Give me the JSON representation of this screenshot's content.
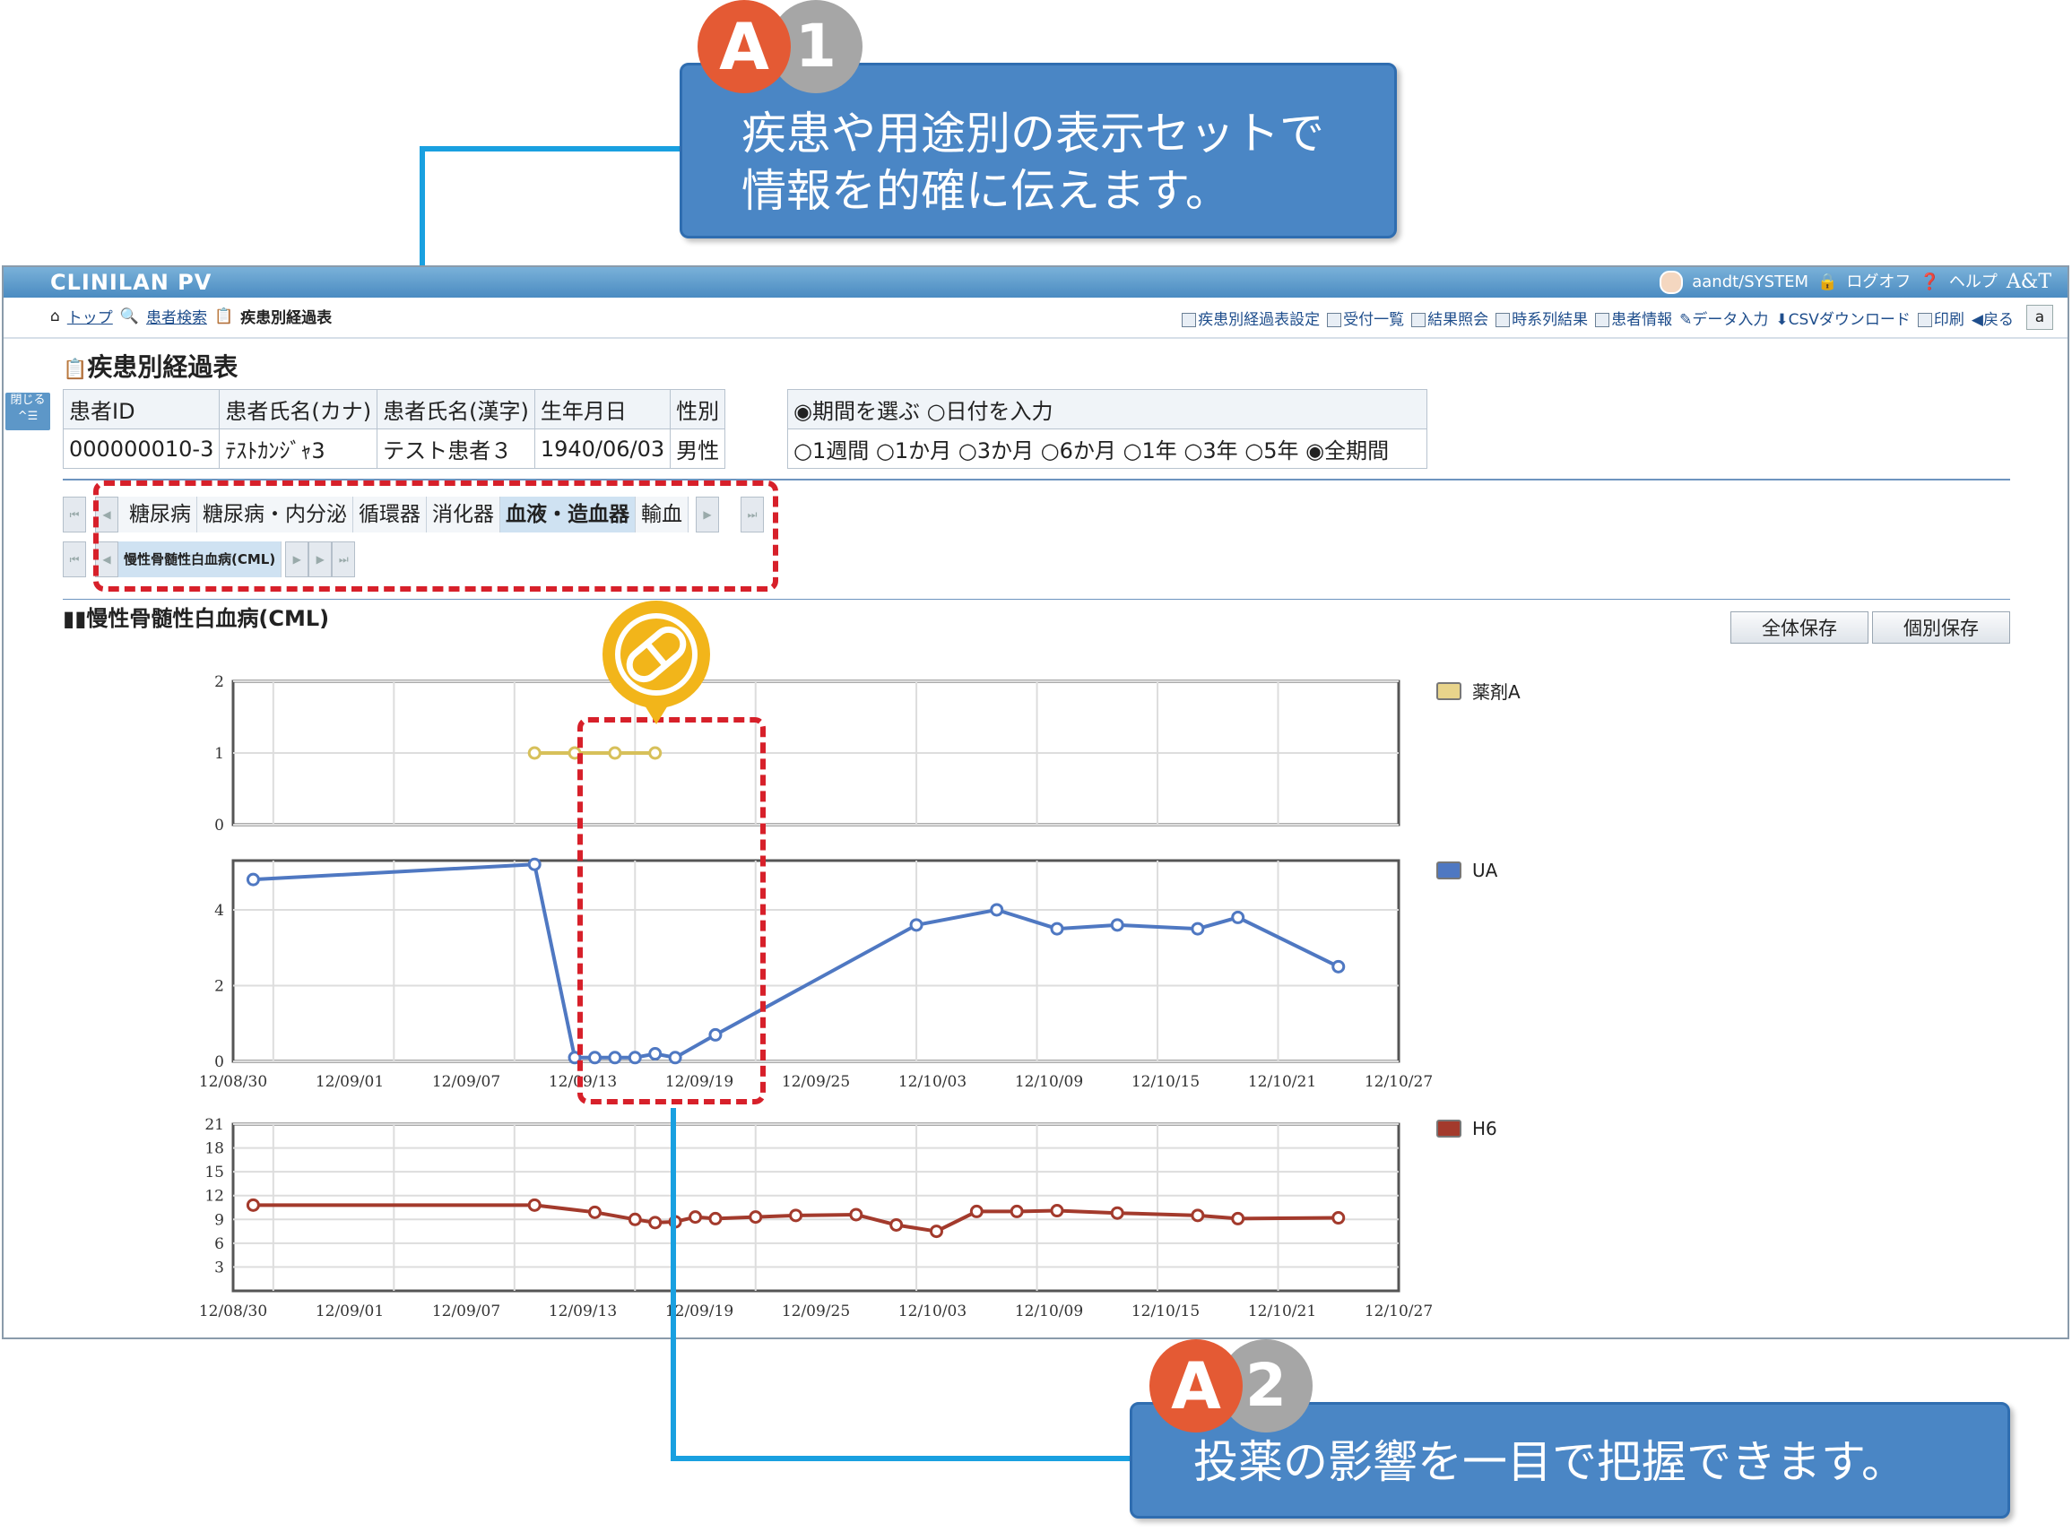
{
  "callouts": {
    "c1": {
      "badge_letter": "A",
      "badge_number": "1",
      "line1": "疾患や用途別の表示セットで",
      "line2": "情報を的確に伝えます。"
    },
    "c2": {
      "badge_letter": "A",
      "badge_number": "2",
      "line1": "投薬の影響を一目で把握できます。"
    }
  },
  "app": {
    "title": "CLINILAN PV",
    "user": "aandt/SYSTEM",
    "logout": "ログオフ",
    "help": "ヘルプ",
    "brand": "A&T",
    "breadcrumb": [
      "トップ",
      "患者検索",
      "疾患別経過表"
    ],
    "toolbar": [
      "疾患別経過表設定",
      "受付一覧",
      "結果照会",
      "時系列結果",
      "患者情報",
      "データ入力",
      "CSVダウンロード",
      "印刷",
      "戻る"
    ],
    "toolbar_last": "a",
    "close_tab": "閉じる",
    "page_title": "疾患別経過表"
  },
  "patient": {
    "headers": [
      "患者ID",
      "患者氏名(カナ)",
      "患者氏名(漢字)",
      "生年月日",
      "性別"
    ],
    "values": [
      "000000010-3",
      "ﾃｽﾄｶﾝｼﾞｬ3",
      "テスト患者３",
      "1940/06/03",
      "男性"
    ]
  },
  "period": {
    "mode_options": [
      "期間を選ぶ",
      "日付を入力"
    ],
    "mode_selected": 0,
    "ranges": [
      "1週間",
      "1か月",
      "3か月",
      "6か月",
      "1年",
      "3年",
      "5年",
      "全期間"
    ],
    "range_selected": 7
  },
  "tabs": {
    "row1": [
      "糖尿病",
      "糖尿病・内分泌",
      "循環器",
      "消化器",
      "血液・造血器",
      "輸血"
    ],
    "row1_active": 4,
    "row2": [
      "慢性骨髄性白血病(CML)"
    ],
    "row2_active": 0
  },
  "chart_section": {
    "title": "慢性骨髄性白血病(CML)",
    "save_all": "全体保存",
    "save_each": "個別保存"
  },
  "chart_data": [
    {
      "type": "line",
      "series": [
        {
          "name": "薬剤A",
          "color": "#d7c05a",
          "x": [
            "2012-09-14",
            "2012-09-16",
            "2012-09-18",
            "2012-09-20"
          ],
          "values": [
            1,
            1,
            1,
            1
          ]
        }
      ],
      "ylim": [
        0,
        2
      ],
      "yticks": [
        0,
        1,
        2
      ],
      "xlim": [
        "2012-08-30",
        "2012-10-27"
      ]
    },
    {
      "type": "line",
      "series": [
        {
          "name": "UA",
          "color": "#4f78c2",
          "x": [
            "2012-08-31",
            "2012-09-14",
            "2012-09-16",
            "2012-09-17",
            "2012-09-18",
            "2012-09-19",
            "2012-09-20",
            "2012-09-21",
            "2012-09-23",
            "2012-10-03",
            "2012-10-07",
            "2012-10-10",
            "2012-10-13",
            "2012-10-17",
            "2012-10-19",
            "2012-10-24"
          ],
          "values": [
            4.8,
            5.2,
            0.1,
            0.1,
            0.1,
            0.1,
            0.2,
            0.1,
            0.7,
            3.6,
            4.0,
            3.5,
            3.6,
            3.5,
            3.8,
            2.5
          ]
        }
      ],
      "ylim": [
        0,
        5.3
      ],
      "yticks": [
        0,
        2,
        4
      ],
      "xlim": [
        "2012-08-30",
        "2012-10-27"
      ],
      "xticks": [
        "12/08/30",
        "12/09/01",
        "12/09/07",
        "12/09/13",
        "12/09/19",
        "12/09/25",
        "12/10/03",
        "12/10/09",
        "12/10/15",
        "12/10/21",
        "12/10/27"
      ]
    },
    {
      "type": "line",
      "series": [
        {
          "name": "H6",
          "color": "#a33a2c",
          "x": [
            "2012-08-31",
            "2012-09-14",
            "2012-09-17",
            "2012-09-19",
            "2012-09-20",
            "2012-09-21",
            "2012-09-22",
            "2012-09-23",
            "2012-09-25",
            "2012-09-27",
            "2012-09-30",
            "2012-10-02",
            "2012-10-04",
            "2012-10-06",
            "2012-10-08",
            "2012-10-10",
            "2012-10-13",
            "2012-10-17",
            "2012-10-19",
            "2012-10-24"
          ],
          "values": [
            10.8,
            10.8,
            9.9,
            9.0,
            8.6,
            8.7,
            9.3,
            9.1,
            9.3,
            9.5,
            9.6,
            8.3,
            7.5,
            10.0,
            10.0,
            10.1,
            9.8,
            9.5,
            9.1,
            9.2
          ]
        }
      ],
      "ylim": [
        0,
        21
      ],
      "yticks": [
        3,
        6,
        9,
        12,
        15,
        18,
        21
      ],
      "xlim": [
        "2012-08-30",
        "2012-10-27"
      ],
      "xticks": [
        "12/08/30",
        "12/09/01",
        "12/09/07",
        "12/09/13",
        "12/09/19",
        "12/09/25",
        "12/10/03",
        "12/10/09",
        "12/10/15",
        "12/10/21",
        "12/10/27"
      ]
    }
  ]
}
